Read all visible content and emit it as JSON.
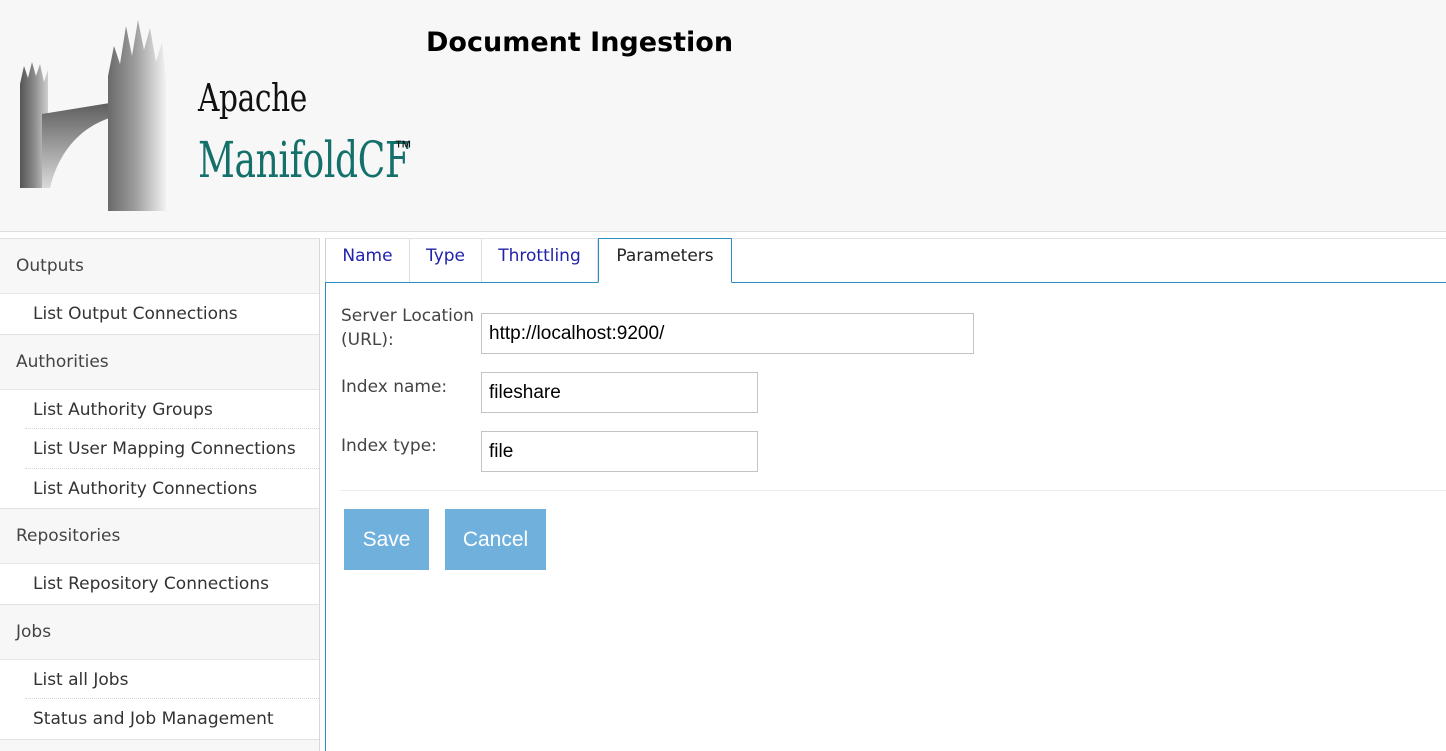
{
  "header": {
    "logo": {
      "line1": "Apache",
      "line2": "ManifoldCF",
      "trademark": "™"
    },
    "title": "Document Ingestion"
  },
  "sidebar": {
    "sections": [
      {
        "label": "Outputs",
        "items": [
          "List Output Connections"
        ]
      },
      {
        "label": "Authorities",
        "items": [
          "List Authority Groups",
          "List User Mapping Connections",
          "List Authority Connections"
        ]
      },
      {
        "label": "Repositories",
        "items": [
          "List Repository Connections"
        ]
      },
      {
        "label": "Jobs",
        "items": [
          "List all Jobs",
          "Status and Job Management"
        ]
      }
    ]
  },
  "tabs": [
    {
      "label": "Name",
      "active": false
    },
    {
      "label": "Type",
      "active": false
    },
    {
      "label": "Throttling",
      "active": false
    },
    {
      "label": "Parameters",
      "active": true
    }
  ],
  "form": {
    "server_location": {
      "label": "Server Location (URL):",
      "value": "http://localhost:9200/"
    },
    "index_name": {
      "label": "Index name:",
      "value": "fileshare"
    },
    "index_type": {
      "label": "Index type:",
      "value": "file"
    }
  },
  "buttons": {
    "save": "Save",
    "cancel": "Cancel"
  },
  "colors": {
    "button_bg": "#6fb0dd",
    "active_tab_border": "#2a8fc0",
    "link": "#2222aa",
    "logo_teal": "#14706a"
  }
}
